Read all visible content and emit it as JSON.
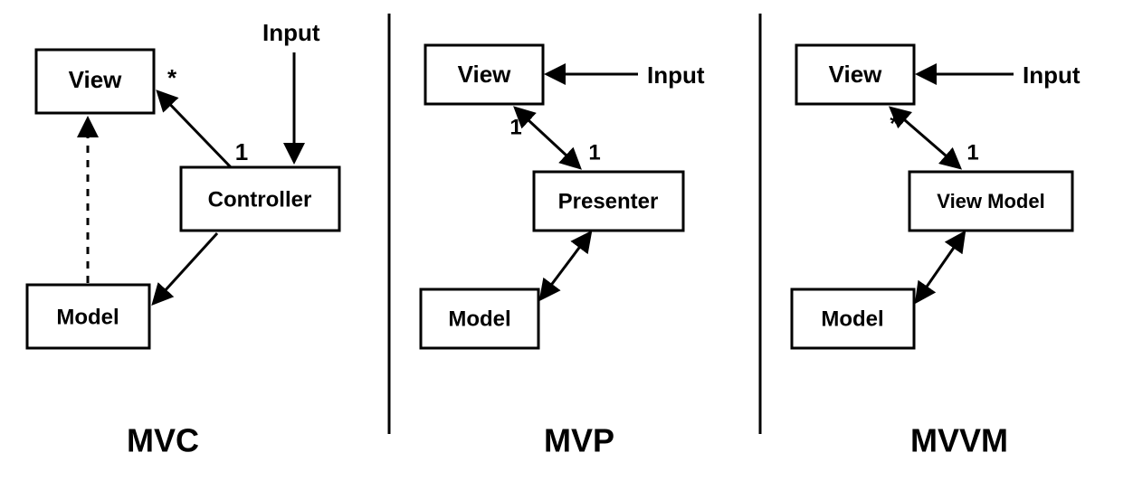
{
  "patterns": {
    "mvc": {
      "title": "MVC",
      "boxes": {
        "view": "View",
        "controller": "Controller",
        "model": "Model"
      },
      "input_label": "Input",
      "multiplicity": {
        "view_side": "*",
        "controller_side": "1"
      },
      "arrows": [
        {
          "from": "Input",
          "to": "Controller",
          "style": "solid",
          "direction": "one-way"
        },
        {
          "from": "Controller",
          "to": "View",
          "style": "solid",
          "direction": "one-way"
        },
        {
          "from": "Controller",
          "to": "Model",
          "style": "solid",
          "direction": "one-way"
        },
        {
          "from": "Model",
          "to": "View",
          "style": "dashed",
          "direction": "one-way"
        }
      ]
    },
    "mvp": {
      "title": "MVP",
      "boxes": {
        "view": "View",
        "presenter": "Presenter",
        "model": "Model"
      },
      "input_label": "Input",
      "multiplicity": {
        "view_side": "1",
        "presenter_side": "1"
      },
      "arrows": [
        {
          "from": "Input",
          "to": "View",
          "style": "solid",
          "direction": "one-way"
        },
        {
          "from": "View",
          "to": "Presenter",
          "style": "solid",
          "direction": "two-way"
        },
        {
          "from": "Presenter",
          "to": "Model",
          "style": "solid",
          "direction": "two-way"
        }
      ]
    },
    "mvvm": {
      "title": "MVVM",
      "boxes": {
        "view": "View",
        "viewmodel": "View Model",
        "model": "Model"
      },
      "input_label": "Input",
      "multiplicity": {
        "view_side": "*",
        "viewmodel_side": "1"
      },
      "arrows": [
        {
          "from": "Input",
          "to": "View",
          "style": "solid",
          "direction": "one-way"
        },
        {
          "from": "View",
          "to": "ViewModel",
          "style": "solid",
          "direction": "two-way"
        },
        {
          "from": "ViewModel",
          "to": "Model",
          "style": "solid",
          "direction": "two-way"
        }
      ]
    }
  }
}
